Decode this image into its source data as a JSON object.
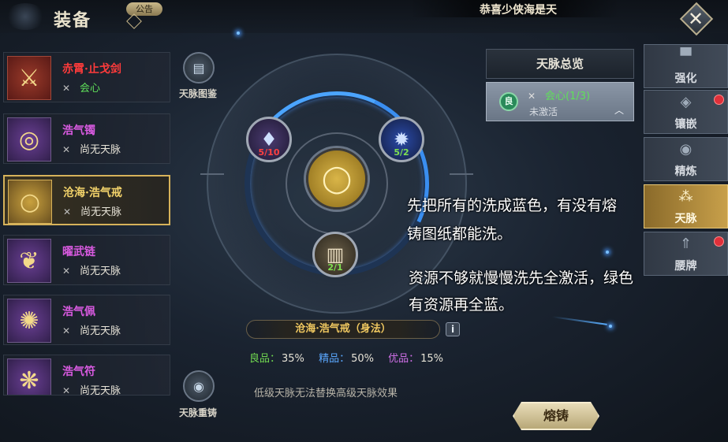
{
  "header": {
    "title": "装备",
    "notice_label": "公告",
    "marquee_text": "恭喜少侠海是天",
    "close_icon": "close-icon"
  },
  "equipment": [
    {
      "name": "赤霄·止戈剑",
      "sub": "会心",
      "name_color": "#ff3b3b",
      "sub_color": "#5fe05a",
      "icon": "sword-icon",
      "rarity": "red"
    },
    {
      "name": "浩气镯",
      "sub": "尚无天脉",
      "name_color": "#d85ae0",
      "sub_color": "#e8e4d8",
      "icon": "bracelet-icon",
      "rarity": "purple"
    },
    {
      "name": "沧海·浩气戒",
      "sub": "尚无天脉",
      "name_color": "#f3d36a",
      "sub_color": "#e8e4d8",
      "icon": "ring-icon",
      "rarity": "gold",
      "selected": true
    },
    {
      "name": "曜武链",
      "sub": "尚无天脉",
      "name_color": "#d85ae0",
      "sub_color": "#e8e4d8",
      "icon": "necklace-icon",
      "rarity": "purple"
    },
    {
      "name": "浩气佩",
      "sub": "尚无天脉",
      "name_color": "#d85ae0",
      "sub_color": "#e8e4d8",
      "icon": "pendant-icon",
      "rarity": "purple"
    },
    {
      "name": "浩气符",
      "sub": "尚无天脉",
      "name_color": "#d85ae0",
      "sub_color": "#e8e4d8",
      "icon": "talisman-icon",
      "rarity": "purple"
    }
  ],
  "circle": {
    "atlas_label": "天脉图鉴",
    "recast_label": "天脉重铸",
    "nodes": [
      {
        "icon": "crystal-icon",
        "count": "5/10",
        "count_color": "red"
      },
      {
        "icon": "blue-flame-icon",
        "count": "5/2",
        "count_color": "green"
      },
      {
        "icon": "scroll-icon",
        "count": "2/1",
        "count_color": "green"
      }
    ],
    "center_icon": "ring-icon"
  },
  "selected_item_plate": "沧海·浩气戒（身法）",
  "quality": {
    "good_label": "良品：",
    "good_value": "35%",
    "fine_label": "精品：",
    "fine_value": "50%",
    "excellent_label": "优品：",
    "excellent_value": "15%"
  },
  "hint": "低级天脉无法替换高级天脉效果",
  "overview": {
    "title": "天脉总览",
    "entry_badge": "良",
    "entry_name": "会心(1/3)",
    "entry_status": "未激活"
  },
  "tabs": [
    {
      "label": "强化",
      "icon": "anvil-icon",
      "red_dot": false
    },
    {
      "label": "镶嵌",
      "icon": "gem-socket-icon",
      "red_dot": true
    },
    {
      "label": "精炼",
      "icon": "refine-icon",
      "red_dot": false
    },
    {
      "label": "天脉",
      "icon": "constellation-icon",
      "red_dot": false,
      "active": true
    },
    {
      "label": "腰牌",
      "icon": "badge-icon",
      "red_dot": true
    }
  ],
  "notes": {
    "line1": "先把所有的洗成蓝色，有没有熔",
    "line2": "铸图纸都能洗。",
    "line3": "资源不够就慢慢洗先全激活，绿色",
    "line4": "有资源再全蓝。"
  },
  "forge_button": "熔铸",
  "colors": {
    "accent_gold": "#d6b25a",
    "active_tab": "#c8a04a",
    "red_dot": "#e0303a"
  }
}
